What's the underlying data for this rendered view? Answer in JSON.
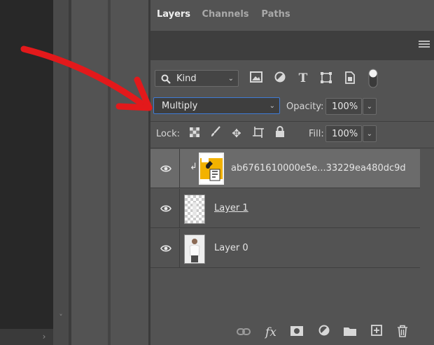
{
  "tabs": [
    {
      "label": "Layers",
      "active": true
    },
    {
      "label": "Channels",
      "active": false
    },
    {
      "label": "Paths",
      "active": false
    }
  ],
  "filter": {
    "kind_label": "Kind"
  },
  "blend": {
    "mode": "Multiply",
    "opacity_label": "Opacity:",
    "opacity_value": "100%"
  },
  "lock": {
    "label": "Lock:",
    "fill_label": "Fill:",
    "fill_value": "100%"
  },
  "layers": [
    {
      "name": "ab6761610000e5e...33229ea480dc9d",
      "visible": true,
      "selected": true,
      "clipped": true,
      "smart_object": true
    },
    {
      "name": "Layer 1",
      "visible": true,
      "selected": false
    },
    {
      "name": "Layer 0",
      "visible": true,
      "selected": false
    }
  ],
  "colors": {
    "panel_bg": "#535353",
    "selected_row": "#6b6b6b",
    "focus_border": "#3f7bd6",
    "annotation_arrow": "#e3191b"
  },
  "icons": {
    "filter": [
      "image-filter-icon",
      "adjustment-filter-icon",
      "type-filter-icon",
      "shape-filter-icon",
      "smart-object-filter-icon",
      "filter-toggle-icon"
    ],
    "lock": [
      "lock-transparent-pixels-icon",
      "lock-image-pixels-icon",
      "lock-position-icon",
      "lock-artboard-icon",
      "lock-all-icon"
    ],
    "bottom": [
      "link-layers-icon",
      "fx-icon",
      "add-mask-icon",
      "adjustment-layer-icon",
      "new-group-icon",
      "new-layer-icon",
      "delete-layer-icon"
    ]
  }
}
